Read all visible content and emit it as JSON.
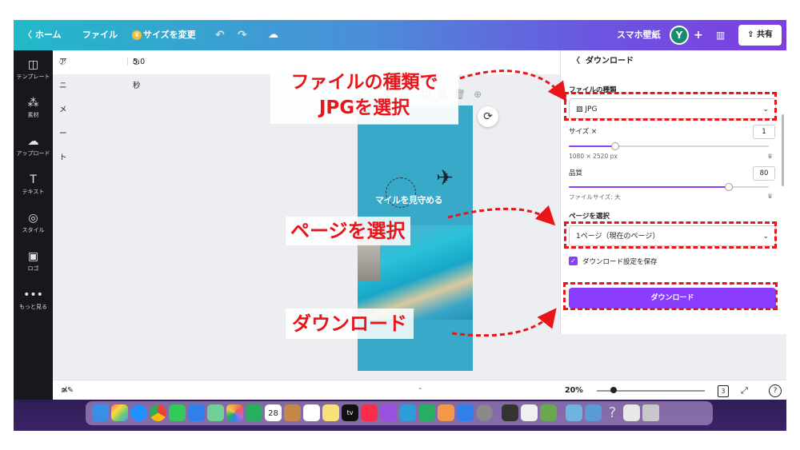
{
  "topbar": {
    "home": "ホーム",
    "file": "ファイル",
    "resize": "サイズを変更",
    "undo_icon": "undo-icon",
    "redo_icon": "redo-icon",
    "cloud_icon": "cloud-check-icon",
    "title": "スマホ壁紙",
    "avatar_initial": "Y",
    "add": "+",
    "analytics_icon": "bar-chart-icon",
    "share": "共有"
  },
  "sidebar": {
    "items": [
      {
        "label": "テンプレート",
        "icon": "template-icon"
      },
      {
        "label": "素材",
        "icon": "elements-icon"
      },
      {
        "label": "アップロード",
        "icon": "upload-icon"
      },
      {
        "label": "テキスト",
        "icon": "text-icon"
      },
      {
        "label": "スタイル",
        "icon": "palette-icon"
      },
      {
        "label": "ロゴ",
        "icon": "logo-icon"
      },
      {
        "label": "もっと見る",
        "icon": "more-icon"
      }
    ]
  },
  "canvas_toolbar": {
    "animate": "アニメート",
    "duration": "5.0秒"
  },
  "design": {
    "slogan": "マイルを見守める"
  },
  "download_panel": {
    "title": "ダウンロード",
    "file_type_label": "ファイルの種類",
    "file_type_value": "JPG",
    "size_label": "サイズ ×",
    "size_value": "1",
    "size_progress": 0.23,
    "dimensions": "1080 × 2520 px",
    "quality_label": "品質",
    "quality_value": "80",
    "quality_progress": 0.8,
    "file_size": "ファイルサイズ: 大",
    "page_select_label": "ページを選択",
    "page_select_value": "1ページ（現在のページ）",
    "save_settings": "ダウンロード設定を保存",
    "download_button": "ダウンロード"
  },
  "bottombar": {
    "notes": "メモ",
    "zoom": "20%",
    "page_count": "3",
    "help": "?"
  },
  "dock": {
    "calendar_date": "28",
    "tv_label": "tv"
  },
  "annotations": {
    "file_type": [
      "ファイルの種類で",
      "JPGを選択"
    ],
    "page": "ページを選択",
    "download": "ダウンロード"
  },
  "colors": {
    "accent": "#8b3dff",
    "annotation": "#e8151b",
    "sidebar": "#17181c"
  }
}
